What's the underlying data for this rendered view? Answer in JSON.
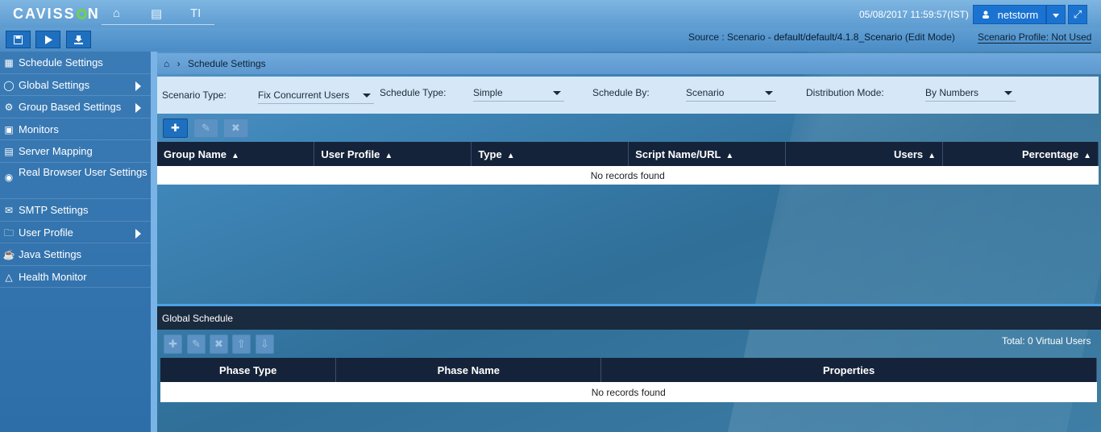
{
  "app": {
    "logo": "CAVISSON",
    "nav_icons": [
      "home-icon",
      "id-card-icon",
      "text-icon"
    ],
    "nav_text_glyph": "TI"
  },
  "header": {
    "datetime": "05/08/2017 11:59:57(IST)",
    "username": "netstorm"
  },
  "toolbar": {
    "source_prefix": "Source : Scenario - ",
    "source_path": "default/default/4.1.8_Scenario",
    "source_mode": " (Edit Mode)",
    "profile_label": "Scenario Profile: ",
    "profile_value": "Not Used"
  },
  "sidebar": {
    "items": [
      {
        "label": "Schedule Settings",
        "icon": "schedule-icon"
      },
      {
        "label": "Global Settings",
        "icon": "globe-icon",
        "submenu": true
      },
      {
        "label": "Group Based Settings",
        "icon": "gear-icon",
        "submenu": true
      },
      {
        "label": "Monitors",
        "icon": "monitor-icon"
      },
      {
        "label": "Server Mapping",
        "icon": "server-icon"
      },
      {
        "label": "Real Browser User Settings",
        "icon": "browser-icon"
      },
      {
        "label": "SMTP Settings",
        "icon": "mail-icon"
      },
      {
        "label": "User Profile",
        "icon": "folder-icon",
        "submenu": true
      },
      {
        "label": "Java Settings",
        "icon": "java-icon"
      },
      {
        "label": "Health Monitor",
        "icon": "health-icon"
      }
    ]
  },
  "breadcrumb": {
    "current": "Schedule Settings"
  },
  "filters": {
    "scenario_type_label": "Scenario Type:",
    "scenario_type_value": "Fix Concurrent Users",
    "schedule_type_label": "Schedule Type:",
    "schedule_type_value": "Simple",
    "schedule_by_label": "Schedule By:",
    "schedule_by_value": "Scenario",
    "distribution_label": "Distribution Mode:",
    "distribution_value": "By Numbers"
  },
  "group_table": {
    "columns": [
      "Group Name",
      "User Profile",
      "Type",
      "Script Name/URL",
      "Users",
      "Percentage"
    ],
    "empty": "No records found"
  },
  "global_schedule": {
    "title": "Global Schedule",
    "total": "Total: 0 Virtual Users",
    "columns": [
      "Phase Type",
      "Phase Name",
      "Properties"
    ],
    "empty": "No records found"
  },
  "colors": {
    "accent": "#1f6fbf",
    "header_dark": "#15233a"
  }
}
